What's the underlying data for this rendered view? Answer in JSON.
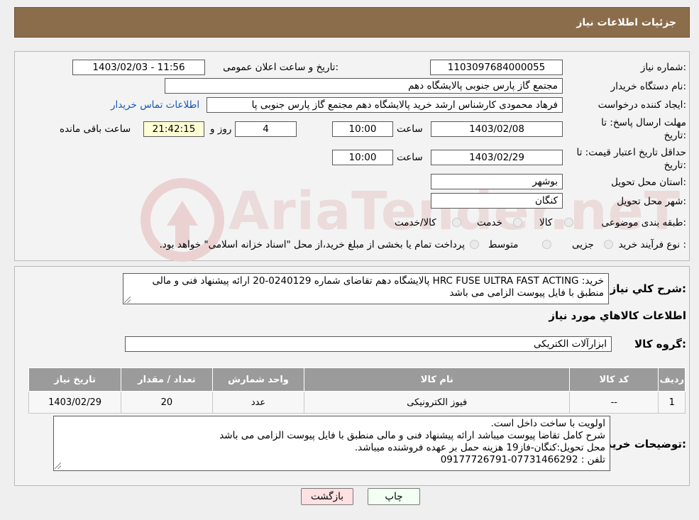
{
  "header": {
    "title": "جزئیات اطلاعات نیاز"
  },
  "form": {
    "need_number_label": "شماره نیاز:",
    "need_number": "1103097684000055",
    "announce_label": "تاریخ و ساعت اعلان عمومی:",
    "announce_value": "1403/02/03 - 11:56",
    "buyer_org_label": "نام دستگاه خریدار:",
    "buyer_org": "مجتمع گاز پارس جنوبی  پالایشگاه دهم",
    "creator_label": "ایجاد کننده درخواست:",
    "creator": "فرهاد محمودی کارشناس ارشد خرید پالایشگاه دهم  مجتمع گاز پارس جنوبی  پا",
    "contact_link": "اطلاعات تماس خریدار",
    "deadline_label_1": "مهلت ارسال پاسخ: تا",
    "deadline_label_2": "تاریخ:",
    "deadline_date": "1403/02/08",
    "time_label": "ساعت",
    "deadline_time": "10:00",
    "days_value": "4",
    "days_label": "روز و",
    "remaining_time": "21:42:15",
    "remaining_label": "ساعت باقی مانده",
    "validity_label_1": "حداقل تاریخ اعتبار قیمت: تا",
    "validity_label_2": "تاریخ:",
    "validity_date": "1403/02/29",
    "validity_time": "10:00",
    "province_label": "استان محل تحویل:",
    "province": "بوشهر",
    "city_label": "شهر محل تحویل:",
    "city": "کنگان",
    "category_label": "طبقه بندی موضوعی:",
    "category_options": [
      "کالا",
      "خدمت",
      "کالا/خدمت"
    ],
    "process_label": "نوع فرآیند خرید :",
    "process_options": [
      "جزیی",
      "متوسط"
    ],
    "process_note": "پرداخت تمام یا بخشی از مبلغ خرید،از محل \"اسناد خزانه اسلامی\" خواهد بود."
  },
  "summary": {
    "label": "شرح کلي نياز:",
    "text": "خرید:  HRC FUSE ULTRA FAST ACTING   پالایشگاه دهم تقاضای شماره 0240129-20 ارائه پیشنهاد فنی و مالی منطبق با فایل پیوست الزامی می باشد"
  },
  "goods_section_title": "اطلاعات کالاهاي مورد نياز",
  "goods_group_label": "گروه کالا:",
  "goods_group": "ابزارآلات الکتریکی",
  "table": {
    "headers": [
      "ردیف",
      "کد کالا",
      "نام کالا",
      "واحد شمارش",
      "تعداد / مقدار",
      "تاریخ نیاز"
    ],
    "rows": [
      [
        "1",
        "--",
        "فیوز الکترونیکی",
        "عدد",
        "20",
        "1403/02/29"
      ]
    ]
  },
  "notes": {
    "label": "توضیحات خریدار:",
    "lines": [
      "اولویت با ساخت داخل است.",
      "شرح کامل تقاضا پیوست میباشد ارائه پیشنهاد فنی و مالی منطبق با فایل پیوست الزامی می باشد",
      "محل تحویل:کنگان-فاز19 هزینه حمل بر عهده فروشنده میباشد.",
      "تلفن : 07731466292-09177726791"
    ]
  },
  "buttons": {
    "print": "چاپ",
    "back": "بازگشت"
  },
  "watermark": "AriaTender.neT"
}
